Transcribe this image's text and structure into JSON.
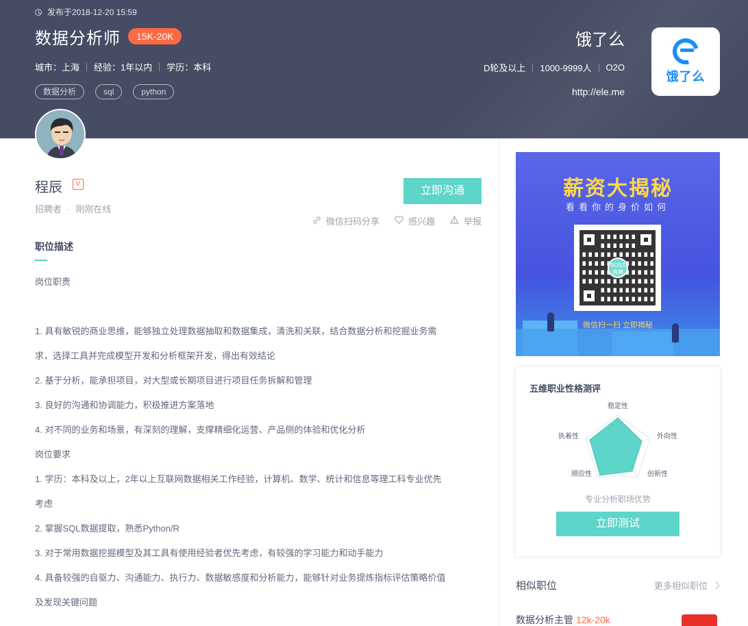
{
  "header": {
    "published": "发布于2018-12-20 15:59",
    "job_title": "数据分析师",
    "salary": "15K-20K",
    "meta": [
      "城市：上海",
      "经验：1年以内",
      "学历：本科"
    ],
    "tags": [
      "数据分析",
      "sql",
      "python"
    ]
  },
  "company": {
    "name": "饿了么",
    "meta": [
      "D轮及以上",
      "1000-9999人",
      "O2O"
    ],
    "url": "http://ele.me",
    "logo_text": "饿了么",
    "brand_color": "#1a8cff"
  },
  "recruiter": {
    "name": "程辰",
    "verified_mark": "V",
    "role": "招聘者",
    "separator": "·",
    "online_status": "刚刚在线"
  },
  "actions": {
    "chat_label": "立即沟通",
    "share_label": "微信扫码分享",
    "interest_label": "感兴趣",
    "report_label": "举报"
  },
  "description": {
    "section_title": "职位描述",
    "lines": [
      "岗位职责",
      "",
      "1. 具有敏锐的商业思维，能够独立处理数据抽取和数据集成，清洗和关联，结合数据分析和挖掘业务需",
      "求，选择工具并完成模型开发和分析框架开发，得出有效结论",
      "2. 基于分析，能承担项目，对大型或长期项目进行项目任务拆解和管理",
      "3. 良好的沟通和协调能力，积极推进方案落地",
      "4. 对不同的业务和场景，有深刻的理解，支撑精细化运营、产品侧的体验和优化分析",
      "岗位要求",
      "1. 学历：本科及以上，2年以上互联网数据相关工作经验，计算机、数学、统计和信息等理工科专业优先",
      "考虑",
      "2. 掌握SQL数据提取，熟悉Python/R",
      "3. 对于常用数据挖掘模型及其工具有使用经验者优先考虑，有较强的学习能力和动手能力",
      "4. 具备较强的自驱力、沟通能力、执行力、数据敏感度和分析能力，能够针对业务提炼指标评估策略价值",
      "及发现关键问题"
    ]
  },
  "promo": {
    "title": "薪资大揭秘",
    "subtitle": "看看你的身价如何",
    "qr_logo": "BOSS直聘",
    "cta": "微信扫一扫  立即揭秘"
  },
  "personality_test": {
    "title": "五维职业性格测评",
    "dimensions": [
      "稳定性",
      "外向性",
      "创新性",
      "顺应性",
      "执着性"
    ],
    "caption": "专业分析职场优势",
    "button_label": "立即测试",
    "accent": "#5dd5c8"
  },
  "similar": {
    "title": "相似职位",
    "more_label": "更多相似职位",
    "first_job_title": "数据分析主管",
    "first_job_salary": "12k-20k"
  },
  "colors": {
    "banner": "#464c63",
    "accent": "#5dd5c8",
    "salary": "#fa6a43"
  }
}
